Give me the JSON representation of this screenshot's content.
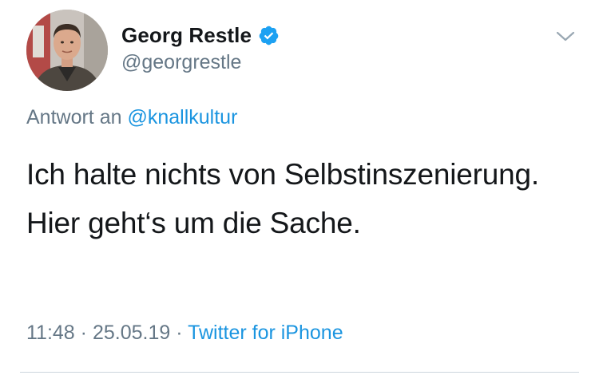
{
  "tweet": {
    "author": {
      "display_name": "Georg Restle",
      "handle": "@georgrestle",
      "verified": true,
      "avatar_icon": "profile-photo"
    },
    "reply_prefix": "Antwort an",
    "reply_to": "@knallkultur",
    "text": "Ich halte nichts von Selbstinszenierung. Hier geht‘s um die Sache.",
    "time": "11:48",
    "separator": "·",
    "date": "25.05.19",
    "source": "Twitter for iPhone",
    "menu_icon": "chevron-down-icon"
  },
  "colors": {
    "text": "#14171a",
    "secondary": "#657786",
    "link": "#1b95e0",
    "verified": "#1da1f2",
    "divider": "#ccd6dd"
  }
}
